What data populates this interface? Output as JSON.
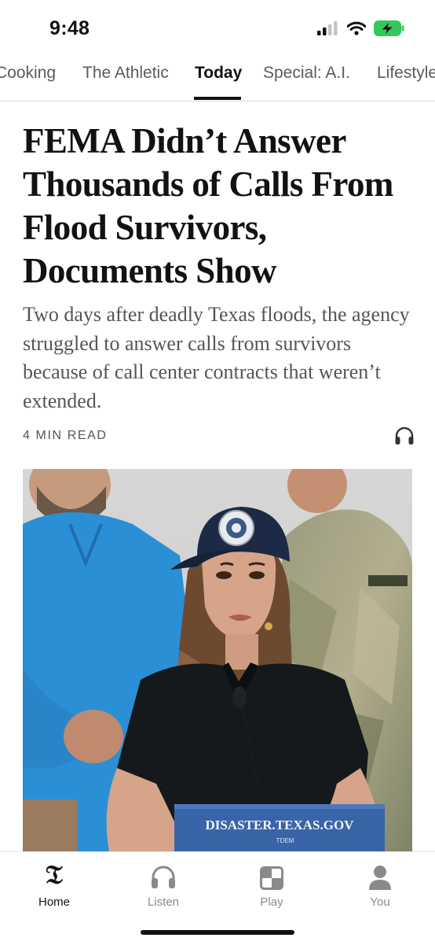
{
  "status_bar": {
    "time": "9:48"
  },
  "section_tabs": [
    {
      "label": "Cooking",
      "active": false
    },
    {
      "label": "The Athletic",
      "active": false
    },
    {
      "label": "Today",
      "active": true
    },
    {
      "label": "Special: A.I.",
      "active": false
    },
    {
      "label": "Lifestyle",
      "active": false
    }
  ],
  "article": {
    "headline": "FEMA Didn’t Answer Thousands of Calls From Flood Survivors, Documents Show",
    "summary": "Two days after deadly Texas floods, the agency struggled to answer calls from survivors because of call center contracts that weren’t extended.",
    "read_time": "4 MIN READ",
    "listen_icon": "headphones-icon",
    "photo": {
      "sign_text": "DISASTER.TEXAS.GOV",
      "sign_subtext": "TDEM"
    }
  },
  "tab_bar": [
    {
      "label": "Home",
      "icon": "nyt-logo-icon",
      "active": true
    },
    {
      "label": "Listen",
      "icon": "headphones-icon",
      "active": false
    },
    {
      "label": "Play",
      "icon": "puzzle-grid-icon",
      "active": false
    },
    {
      "label": "You",
      "icon": "person-icon",
      "active": false
    }
  ],
  "colors": {
    "text": "#121212",
    "secondary": "#555555",
    "battery": "#34c759"
  }
}
